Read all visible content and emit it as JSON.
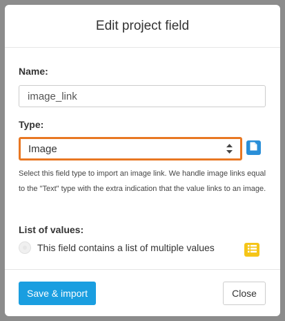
{
  "dialog": {
    "title": "Edit project field"
  },
  "form": {
    "name_label": "Name:",
    "name_value": "image_link",
    "type_label": "Type:",
    "type_value": "Image",
    "type_help": "Select this field type to import an image link. We handle image links equal to the \"Text\" type with the extra indication that the value links to an image.",
    "list_label": "List of values:",
    "list_checkbox_label": "This field contains a list of multiple values",
    "list_checkbox_checked": false
  },
  "footer": {
    "save_label": "Save & import",
    "close_label": "Close"
  },
  "icons": {
    "type_doc": "document-icon",
    "list": "list-icon"
  },
  "colors": {
    "primary": "#1a9ee0",
    "focus_border": "#e87722",
    "doc_icon_bg": "#2a8fd8",
    "list_icon_bg": "#f5c518"
  }
}
